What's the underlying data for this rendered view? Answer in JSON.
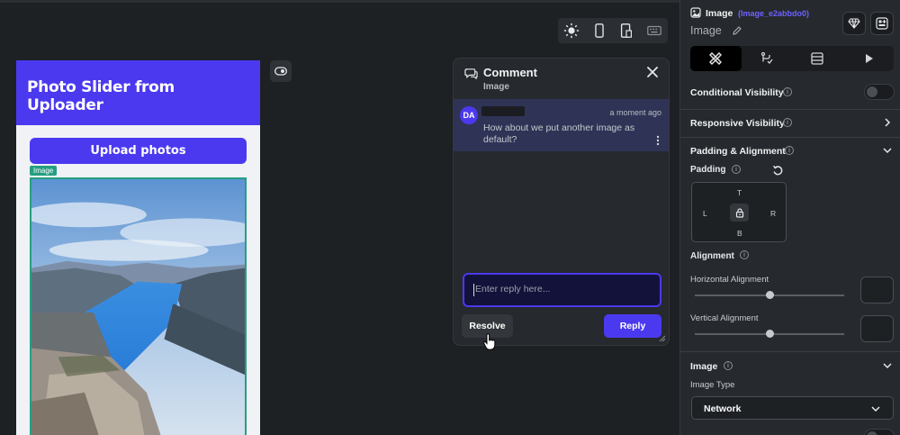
{
  "view_toolbar": {
    "icons": [
      "sun-icon",
      "phone-icon",
      "tablet-icon",
      "keyboard-icon"
    ]
  },
  "phone": {
    "title": "Photo Slider from Uploader",
    "upload_label": "Upload photos",
    "image_tag": "Image"
  },
  "comment": {
    "title": "Comment",
    "subtitle": "Image",
    "avatar_initials": "DA",
    "time": "a moment ago",
    "text": "How about we put another image as default?",
    "reply_placeholder": "Enter reply here...",
    "resolve_label": "Resolve",
    "reply_label": "Reply"
  },
  "panel": {
    "widget_type": "Image",
    "widget_id": "(Image_e2abbdo0)",
    "widget_name": "Image",
    "conditional_visibility": "Conditional Visibility",
    "responsive_visibility": "Responsive Visibility",
    "padding_alignment": "Padding & Alignment",
    "padding": "Padding",
    "pad_t": "T",
    "pad_l": "L",
    "pad_r": "R",
    "pad_b": "B",
    "alignment": "Alignment",
    "horizontal_alignment": "Horizontal Alignment",
    "vertical_alignment": "Vertical Alignment",
    "horizontal_value": 0.5,
    "vertical_value": 0.5,
    "image_section": "Image",
    "image_type_label": "Image Type",
    "image_type_value": "Network"
  },
  "colors": {
    "accent": "#4b39ef",
    "selection": "#259f82",
    "panel_bg": "#26292d",
    "canvas_bg": "#1e2124"
  }
}
